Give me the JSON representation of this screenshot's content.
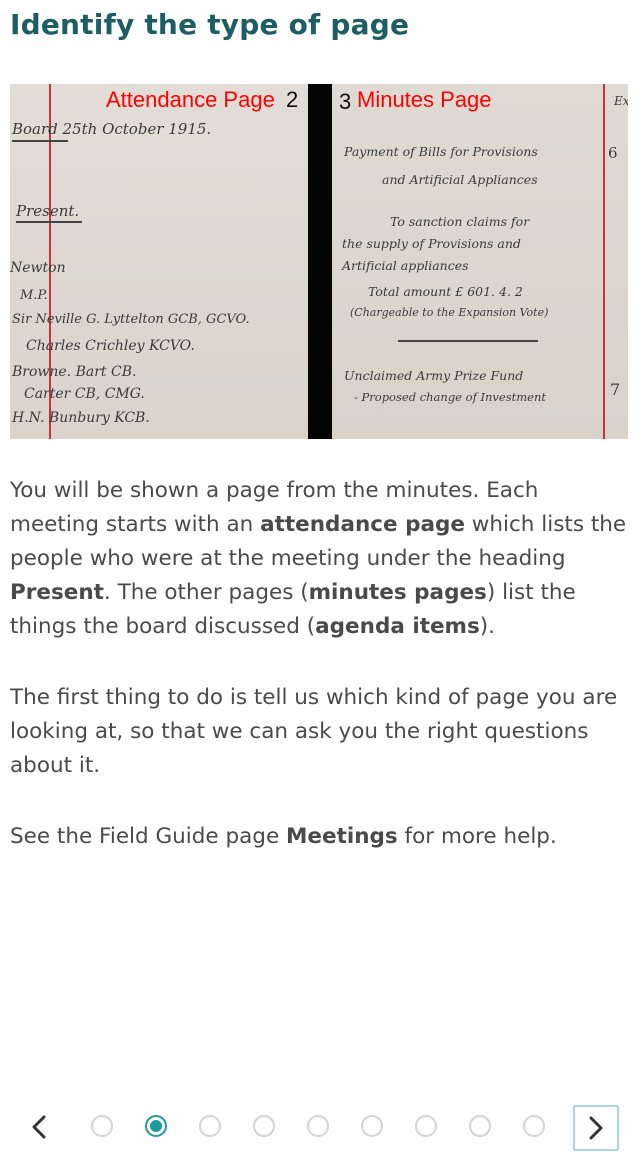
{
  "page": {
    "title": "Identify the type of page"
  },
  "figure": {
    "attendance_label": "Attendance Page",
    "left_page_number": "2",
    "right_page_number": "3",
    "minutes_label": "Minutes Page",
    "left_handwriting": {
      "header": "Board 25th October 1915.",
      "present": "Present.",
      "line1": "Newton",
      "line2": "M.P.",
      "line3": "Sir Neville G. Lyttelton GCB, GCVO.",
      "line4": "Charles Crichley KCVO.",
      "line5": "Browne. Bart CB.",
      "line6": "Carter CB, CMG.",
      "line7": "H.N. Bunbury KCB."
    },
    "right_handwriting": {
      "item1_title": "Payment of Bills for Provisions",
      "item1_title2": "and Artificial Appliances",
      "item1_num": "6",
      "item1_body1": "To sanction claims for",
      "item1_body2": "the supply of Provisions and",
      "item1_body3": "Artificial appliances",
      "item1_body4": "Total amount £ 601. 4. 2",
      "item1_body5": "(Chargeable to the Expansion Vote)",
      "item2_title": "Unclaimed Army Prize Fund",
      "item2_sub": "- Proposed change of Investment",
      "item2_num": "7",
      "edge_mark": "Ex"
    }
  },
  "body": {
    "p1_a": "You will be shown a page from the minutes. Each meeting starts with an ",
    "p1_b": "attendance page",
    "p1_c": " which lists the people who were at the meeting under the heading ",
    "p1_d": "Present",
    "p1_e": ". The other pages (",
    "p1_f": "minutes pages",
    "p1_g": ") list the things the board discussed (",
    "p1_h": "agenda items",
    "p1_i": ").",
    "p2": "The first thing to do is tell us which kind of page you are looking at, so that we can ask you the right questions about it.",
    "p3_a": "See the Field Guide page ",
    "p3_b": "Meetings",
    "p3_c": " for more help."
  },
  "pager": {
    "total_steps": 9,
    "current_step": 2,
    "prev_icon": "chevron-left-icon",
    "next_icon": "chevron-right-icon",
    "accent_color": "#1f9b9b",
    "inactive_color": "#d3d3d3"
  }
}
